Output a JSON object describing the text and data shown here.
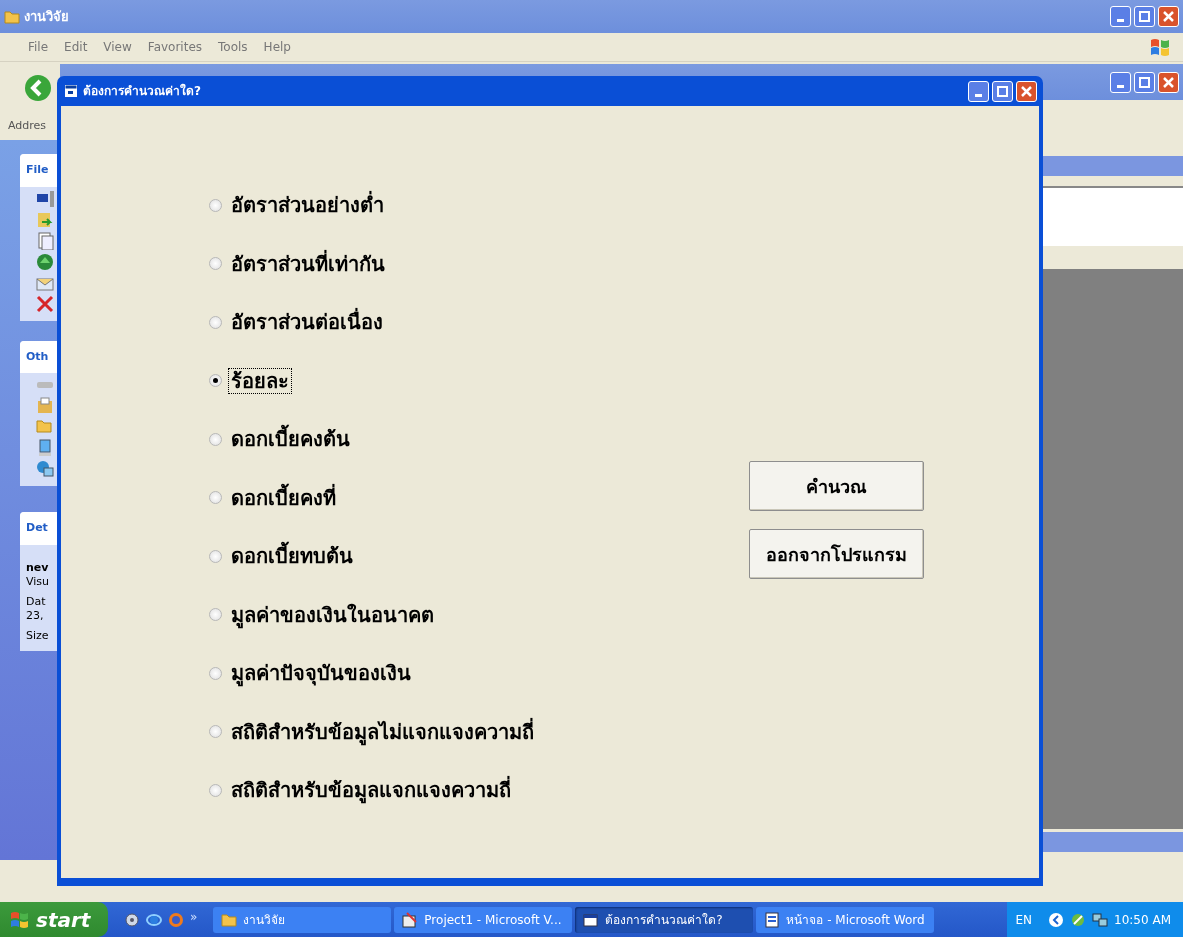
{
  "explorer": {
    "title": "งานวิจัย",
    "menu": [
      "File",
      "Edit",
      "View",
      "Favorites",
      "Tools",
      "Help"
    ],
    "address_label": "Addres",
    "task_pane": [
      {
        "kind": "tasks",
        "title": "File"
      },
      {
        "kind": "places",
        "title": "Oth"
      },
      {
        "kind": "details",
        "title": "Det",
        "lines": [
          "nev",
          "Visu",
          "Dat",
          "23,",
          "Size"
        ]
      }
    ]
  },
  "dialog": {
    "title": "ต้องการคำนวณค่าใด?",
    "options": [
      {
        "label": "อัตราส่วนอย่างต่ำ",
        "selected": false,
        "focused": false
      },
      {
        "label": "อัตราส่วนที่เท่ากัน",
        "selected": false,
        "focused": false
      },
      {
        "label": "อัตราส่วนต่อเนื่อง",
        "selected": false,
        "focused": false
      },
      {
        "label": "ร้อยละ",
        "selected": true,
        "focused": true
      },
      {
        "label": "ดอกเบี้ยคงต้น",
        "selected": false,
        "focused": false
      },
      {
        "label": "ดอกเบี้ยคงที่",
        "selected": false,
        "focused": false
      },
      {
        "label": "ดอกเบี้ยทบต้น",
        "selected": false,
        "focused": false
      },
      {
        "label": "มูลค่าของเงินในอนาคต",
        "selected": false,
        "focused": false
      },
      {
        "label": "มูลค่าปัจจุบันของเงิน",
        "selected": false,
        "focused": false
      },
      {
        "label": "สถิติสำหรับข้อมูลไม่แจกแจงความถี่",
        "selected": false,
        "focused": false
      },
      {
        "label": "สถิติสำหรับข้อมูลแจกแจงความถี่",
        "selected": false,
        "focused": false
      }
    ],
    "buttons": [
      "คำนวณ",
      "ออกจากโปรแกรม"
    ]
  },
  "taskbar": {
    "start": "start",
    "more": "»",
    "tasks": [
      {
        "label": "งานวิจัย",
        "selected": false,
        "kind": "folder"
      },
      {
        "label": "Project1 - Microsoft V...",
        "selected": false,
        "kind": "vb"
      },
      {
        "label": "ต้องการคำนวณค่าใด?",
        "selected": true,
        "kind": "form"
      },
      {
        "label": "หน้าจอ - Microsoft Word",
        "selected": false,
        "kind": "word"
      }
    ],
    "language": "EN",
    "time": "10:50 AM"
  }
}
